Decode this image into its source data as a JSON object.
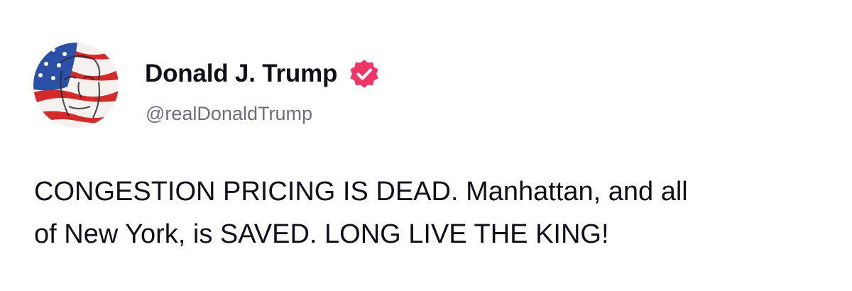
{
  "author": {
    "display_name": "Donald J. Trump",
    "handle": "@realDonaldTrump",
    "verified_icon": "verified-badge-icon",
    "avatar_icon": "flag-portrait-avatar"
  },
  "post": {
    "lines": [
      "CONGESTION PRICING IS DEAD. Manhattan, and all",
      "of New York, is SAVED. LONG LIVE THE KING!"
    ]
  },
  "colors": {
    "verified_badge": "#f33466",
    "text_primary": "#0f0f1a",
    "text_secondary": "#6b6f80"
  }
}
